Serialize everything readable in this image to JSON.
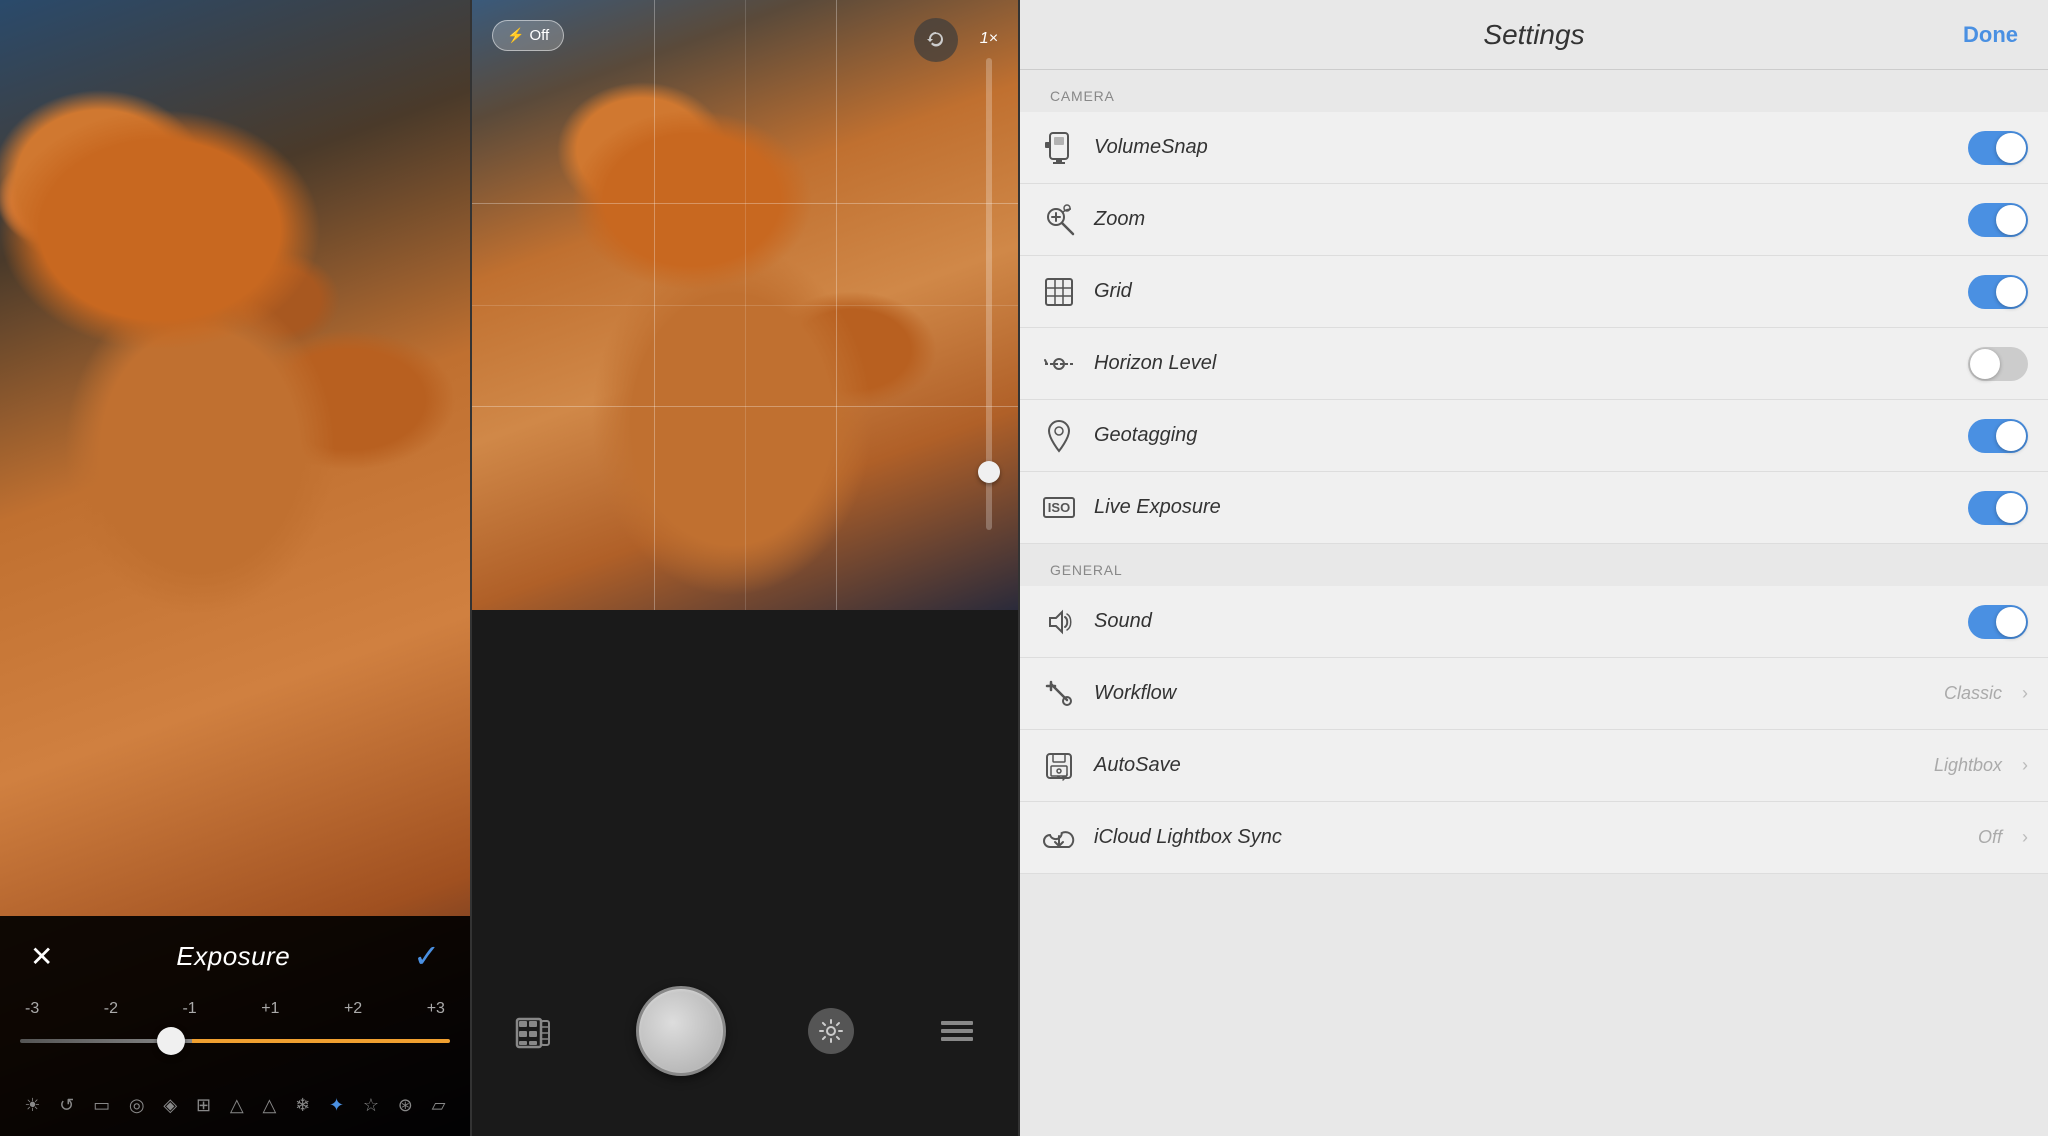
{
  "panel_edit": {
    "title": "Exposure",
    "close_icon": "✕",
    "confirm_icon": "✓",
    "slider": {
      "labels": [
        "-3",
        "-2",
        "-1",
        "+1",
        "+2",
        "+3"
      ],
      "value": "-0.5"
    },
    "tools": [
      "☀",
      "↺",
      "▭",
      "◎",
      "◈",
      "⊞",
      "△",
      "△",
      "❄",
      "✦",
      "☆",
      "⊛",
      "▱"
    ]
  },
  "panel_camera": {
    "flash_label": "Off",
    "flash_icon": "⚡",
    "zoom_label": "1×",
    "grid_lines": true,
    "controls": {
      "film_icon": "🎞",
      "gear_icon": "⚙",
      "list_icon": "≡"
    }
  },
  "panel_settings": {
    "title": "Settings",
    "done_label": "Done",
    "sections": [
      {
        "label": "CAMERA",
        "rows": [
          {
            "id": "volumesnap",
            "icon": "volumesnap",
            "label": "VolumeSnap",
            "toggle": true,
            "value": "on"
          },
          {
            "id": "zoom",
            "icon": "zoom",
            "label": "Zoom",
            "toggle": true,
            "value": "on"
          },
          {
            "id": "grid",
            "icon": "grid",
            "label": "Grid",
            "toggle": true,
            "value": "on"
          },
          {
            "id": "horizon",
            "icon": "horizon",
            "label": "Horizon Level",
            "toggle": true,
            "value": "off"
          },
          {
            "id": "geotagging",
            "icon": "geotagging",
            "label": "Geotagging",
            "toggle": true,
            "value": "on"
          },
          {
            "id": "liveexposure",
            "icon": "iso",
            "label": "Live Exposure",
            "toggle": true,
            "value": "on"
          }
        ]
      },
      {
        "label": "GENERAL",
        "rows": [
          {
            "id": "sound",
            "icon": "sound",
            "label": "Sound",
            "toggle": true,
            "value": "on"
          },
          {
            "id": "workflow",
            "icon": "workflow",
            "label": "Workflow",
            "toggle": false,
            "value": "Classic",
            "has_chevron": true
          },
          {
            "id": "autosave",
            "icon": "autosave",
            "label": "AutoSave",
            "toggle": false,
            "value": "Lightbox",
            "has_chevron": true
          },
          {
            "id": "icloud",
            "icon": "icloud",
            "label": "iCloud Lightbox Sync",
            "toggle": false,
            "value": "Off",
            "has_chevron": true
          }
        ]
      }
    ]
  }
}
